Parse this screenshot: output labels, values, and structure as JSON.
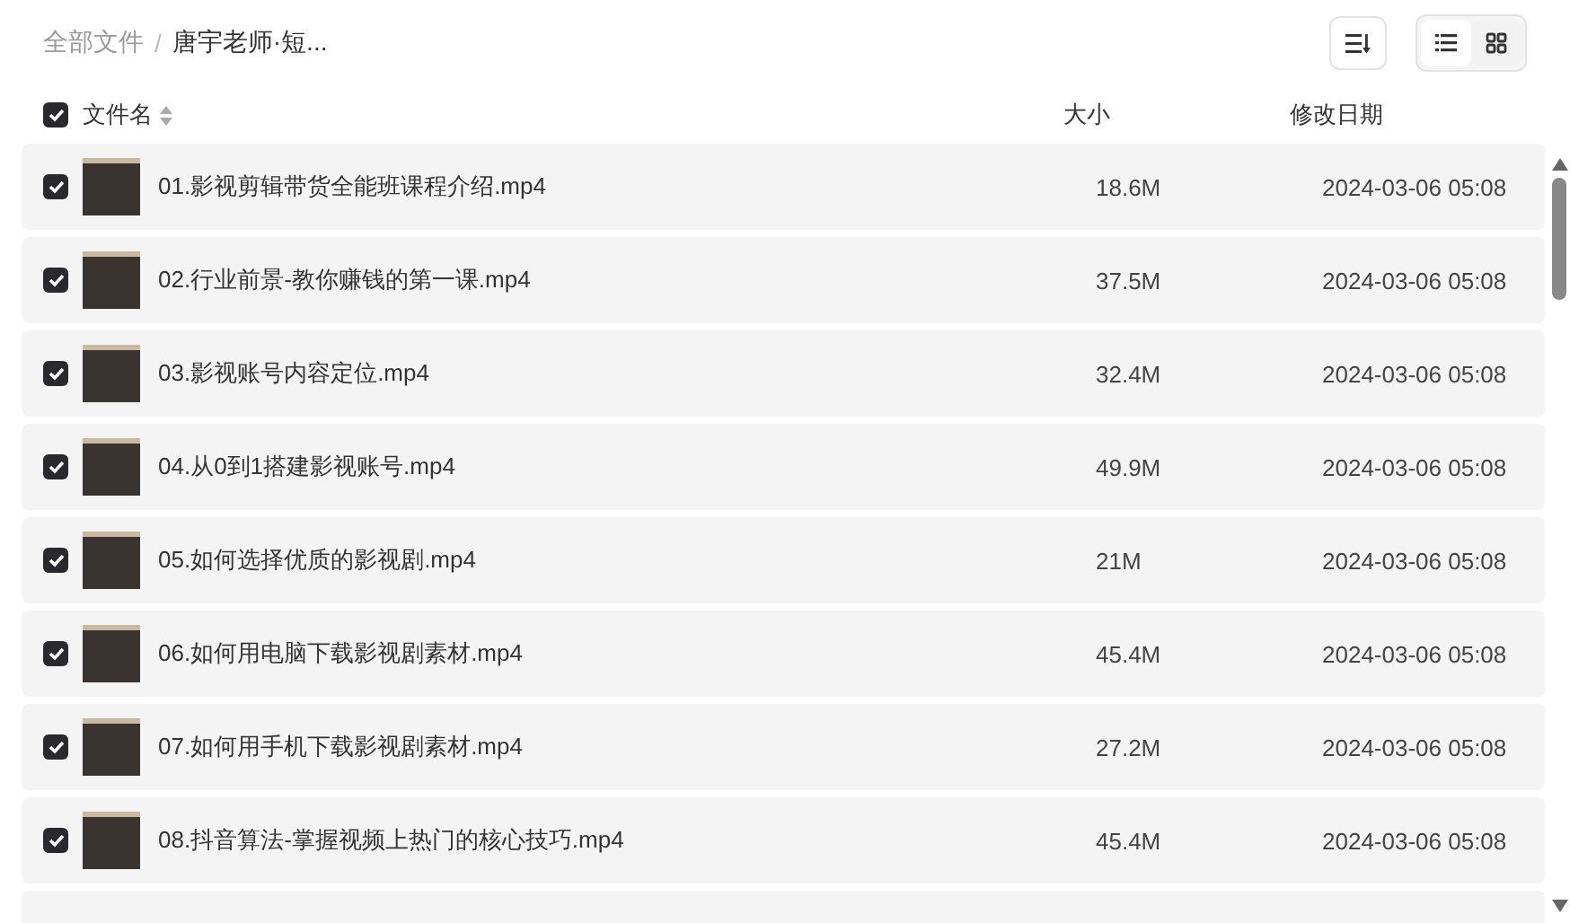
{
  "breadcrumb_separator": "/",
  "breadcrumb": [
    {
      "label": "全部文件",
      "current": false
    },
    {
      "label": "唐宇老师·短...",
      "current": true
    }
  ],
  "view_modes": [
    {
      "kind": "list",
      "selected": true
    },
    {
      "kind": "grid",
      "selected": false
    }
  ],
  "table": {
    "select_all": {
      "checked": true
    },
    "columns": [
      "文件名",
      "大小",
      "修改日期"
    ],
    "rows": [
      {
        "checked": true,
        "name": "01.影视剪辑带货全能班课程介绍.mp4",
        "size": "18.6M",
        "modified": "2024-03-06 05:08"
      },
      {
        "checked": true,
        "name": "02.行业前景-教你赚钱的第一课.mp4",
        "size": "37.5M",
        "modified": "2024-03-06 05:08"
      },
      {
        "checked": true,
        "name": "03.影视账号内容定位.mp4",
        "size": "32.4M",
        "modified": "2024-03-06 05:08"
      },
      {
        "checked": true,
        "name": "04.从0到1搭建影视账号.mp4",
        "size": "49.9M",
        "modified": "2024-03-06 05:08"
      },
      {
        "checked": true,
        "name": "05.如何选择优质的影视剧.mp4",
        "size": "21M",
        "modified": "2024-03-06 05:08"
      },
      {
        "checked": true,
        "name": "06.如何用电脑下载影视剧素材.mp4",
        "size": "45.4M",
        "modified": "2024-03-06 05:08"
      },
      {
        "checked": true,
        "name": "07.如何用手机下载影视剧素材.mp4",
        "size": "27.2M",
        "modified": "2024-03-06 05:08"
      },
      {
        "checked": true,
        "name": "08.抖音算法-掌握视频上热门的核心技巧.mp4",
        "size": "45.4M",
        "modified": "2024-03-06 05:08"
      }
    ]
  }
}
